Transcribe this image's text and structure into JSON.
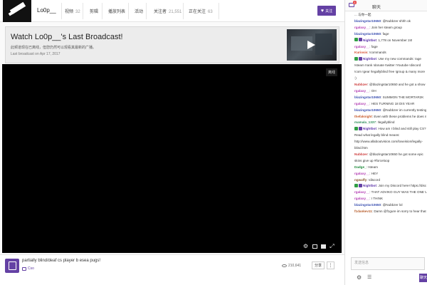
{
  "channel": {
    "name": "Lo0p__",
    "tabs": [
      {
        "label": "视频",
        "count": "32"
      },
      {
        "label": "剪辑",
        "count": ""
      },
      {
        "label": "播放列表",
        "count": ""
      },
      {
        "label": "活动",
        "count": ""
      },
      {
        "label": "关注者",
        "count": "21,551"
      },
      {
        "label": "正在关注",
        "count": "63"
      }
    ],
    "follow_label": "关注"
  },
  "banner": {
    "title": "Watch Lo0p__'s Last Broadcast!",
    "subtitle": "此频道现在已离线，但您仍然可以观看其最新的广播。",
    "date": "Last broadcast on Apr 17, 2017"
  },
  "player": {
    "status_badge": "离线"
  },
  "stream": {
    "title": "partially blind/deaf cs player b esea pugs!",
    "game": "Cso",
    "viewers": "210,641",
    "share_label": "分享",
    "more_label": "⋮"
  },
  "chat": {
    "title": "聊天",
    "notification_count": "1",
    "input_placeholder": "发送信息",
    "send_label": "聊天",
    "messages": [
      {
        "badges": [],
        "user": "",
        "color": "#222",
        "text": "... 与你一起"
      },
      {
        "badges": [],
        "user": "blazingstar10650",
        "color": "#3a4fb0",
        "text": ": @Nubbzer shhh ok"
      },
      {
        "badges": [],
        "user": "rgalaxy__",
        "color": "#b33db3",
        "text": ": Join her steam group"
      },
      {
        "badges": [],
        "user": "blazingstar10650",
        "color": "#3a4fb0",
        "text": ": fage"
      },
      {
        "badges": [
          "green",
          "purple"
        ],
        "user": "Nightbot",
        "color": "#5a32a8",
        "text": ": 1,778 on November 24!"
      },
      {
        "badges": [],
        "user": "rgalaxy__",
        "color": "#b33db3",
        "text": ": fage"
      },
      {
        "badges": [],
        "user": "Kuriosis",
        "color": "#d64b2f",
        "text": ": !commands"
      },
      {
        "badges": [
          "green",
          "purple"
        ],
        "user": "Nightbot",
        "color": "#5a32a8",
        "text": ": Use my new commands: !age !steam !rank !donate !twitter !Youtube !discord !com !gear !legallyblind free !group & many more :)"
      },
      {
        "badges": [],
        "user": "Nubbzer",
        "color": "#cc3b3b",
        "text": ": @blazingstar10650 and he got a show"
      },
      {
        "badges": [],
        "user": "rgalaxy__",
        "color": "#b33db3",
        "text": ": OH"
      },
      {
        "badges": [],
        "user": "blazingstar10650",
        "color": "#3a4fb0",
        "text": ": SUMMON THE MORTAR2K"
      },
      {
        "badges": [],
        "user": "rgalaxy__",
        "color": "#b33db3",
        "text": ": HES TURNING 18 DIS YEAR"
      },
      {
        "badges": [],
        "user": "blazingstar10650",
        "color": "#3a4fb0",
        "text": ": @Nubbzer im currently testing his inventory"
      },
      {
        "badges": [],
        "user": "thefaknight",
        "color": "#c75a2a",
        "text": ": Even with these problems he does not give up #forceloop"
      },
      {
        "badges": [],
        "user": "mamala_1337",
        "color": "#2f8f5a",
        "text": ": !legallyblind"
      },
      {
        "badges": [
          "green",
          "purple"
        ],
        "user": "Nightbot",
        "color": "#5a32a8",
        "text": ": How am I blind and still play CS? Read what legally blind means: http://www.allaboutvision.com/lowvision/legally-blind.htm"
      },
      {
        "badges": [],
        "user": "Nubbzer",
        "color": "#cc3b3b",
        "text": ": @blazingstar10650 he got some epic skins give up #forceloop"
      },
      {
        "badges": [],
        "user": "Dadge_",
        "color": "#1e8a3a",
        "text": ": !steam"
      },
      {
        "badges": [],
        "user": "rgalaxy__",
        "color": "#b33db3",
        "text": ": HEY"
      },
      {
        "badges": [],
        "user": "ngwaffy",
        "color": "#8a5a2f",
        "text": ": !discord"
      },
      {
        "badges": [
          "green",
          "purple"
        ],
        "user": "Nightbot",
        "color": "#5a32a8",
        "text": ": Join my Discord here! https://discord.gg/DuuXCKY"
      },
      {
        "badges": [],
        "user": "rgalaxy__",
        "color": "#b33db3",
        "text": ": THAT ADVIKO GUY WAS THE ONE WHO BULLIED HIM"
      },
      {
        "badges": [],
        "user": "rgalaxy__",
        "color": "#b33db3",
        "text": ": I THINK"
      },
      {
        "badges": [],
        "user": "blazingstar10650",
        "color": "#3a4fb0",
        "text": ": @Nubbzer lol"
      },
      {
        "badges": [],
        "user": "f1dankev11",
        "color": "#b65c2a",
        "text": ": Damn @f1gure im sorry to hear that hope you are ok ?"
      }
    ]
  }
}
